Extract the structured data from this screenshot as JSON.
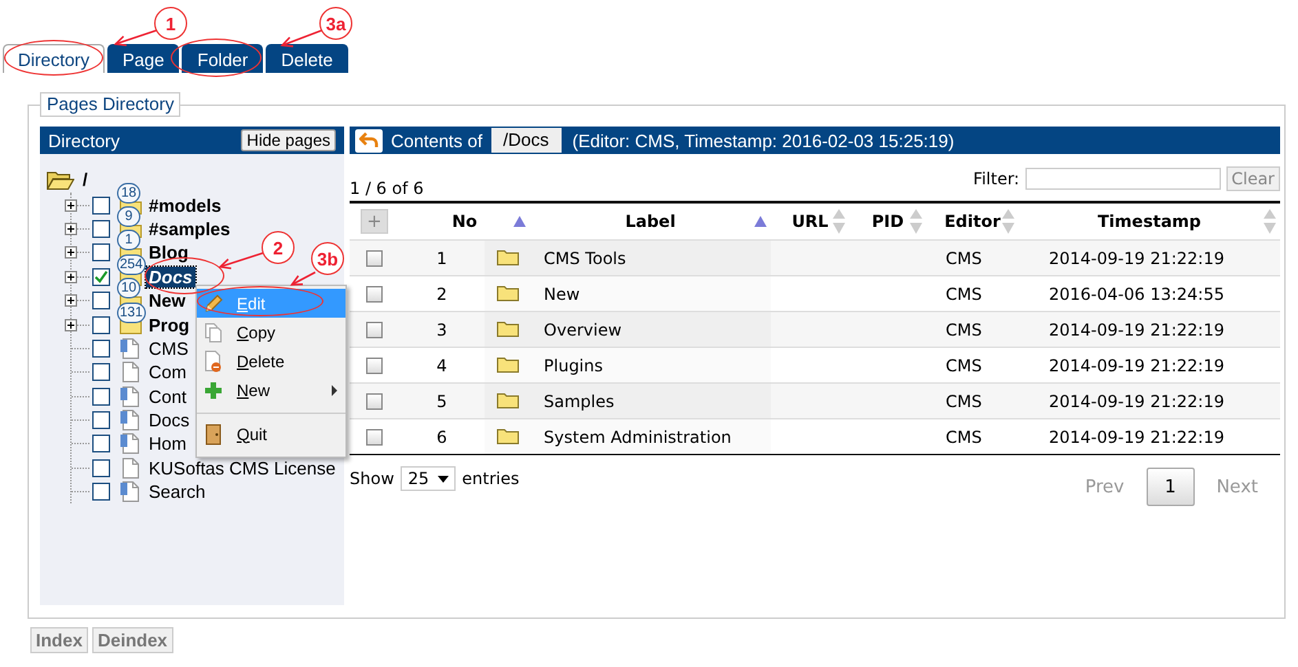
{
  "tabs": [
    {
      "label": "Directory",
      "selected": true
    },
    {
      "label": "Page",
      "selected": false
    },
    {
      "label": "Folder",
      "selected": false
    },
    {
      "label": "Delete",
      "selected": false
    }
  ],
  "panel": {
    "legend": "Pages Directory"
  },
  "directory": {
    "title": "Directory",
    "hide_button": "Hide pages",
    "root": "/",
    "items": [
      {
        "kind": "folder",
        "label": "#models",
        "count": "18",
        "checked": false,
        "selected": false
      },
      {
        "kind": "folder",
        "label": "#samples",
        "count": "9",
        "checked": false,
        "selected": false
      },
      {
        "kind": "folder",
        "label": "Blog",
        "count": "1",
        "checked": false,
        "selected": false
      },
      {
        "kind": "folder",
        "label": "Docs",
        "count": "254",
        "checked": true,
        "selected": true
      },
      {
        "kind": "folder",
        "label": "New",
        "count": "10",
        "checked": false,
        "selected": false
      },
      {
        "kind": "folder",
        "label": "Prog",
        "count": "131",
        "checked": false,
        "selected": false
      },
      {
        "kind": "module-page",
        "label": "CMS",
        "checked": false,
        "selected": false
      },
      {
        "kind": "page",
        "label": "Com",
        "checked": false,
        "selected": false
      },
      {
        "kind": "module-page",
        "label": "Cont",
        "checked": false,
        "selected": false
      },
      {
        "kind": "module-page",
        "label": "Docs",
        "checked": false,
        "selected": false
      },
      {
        "kind": "module-page",
        "label": "Hom",
        "checked": false,
        "selected": false
      },
      {
        "kind": "page",
        "label": "KUSoftas CMS License",
        "checked": false,
        "selected": false
      },
      {
        "kind": "module-page",
        "label": "Search",
        "checked": false,
        "selected": false
      }
    ]
  },
  "context_menu": [
    {
      "label": "Edit",
      "selected": true,
      "submenu": false,
      "separator_before": false
    },
    {
      "label": "Copy",
      "selected": false,
      "submenu": false,
      "separator_before": false
    },
    {
      "label": "Delete",
      "selected": false,
      "submenu": false,
      "separator_before": false
    },
    {
      "label": "New",
      "selected": false,
      "submenu": true,
      "separator_before": false
    },
    {
      "label": "Quit",
      "selected": false,
      "submenu": false,
      "separator_before": true
    }
  ],
  "contents": {
    "label": "Contents of",
    "path": "/Docs",
    "info": "(Editor: CMS, Timestamp: 2016-02-03 15:25:19)"
  },
  "table": {
    "summary": "1 / 6 of 6",
    "filter_label": "Filter:",
    "clear_button": "Clear",
    "add_button": "+",
    "columns": [
      {
        "label": "No",
        "sorted": true
      },
      {
        "label": "Label",
        "sorted": true
      },
      {
        "label": "URL",
        "sorted": false
      },
      {
        "label": "PID",
        "sorted": false
      },
      {
        "label": "Editor",
        "sorted": false
      },
      {
        "label": "Timestamp",
        "sorted": false
      }
    ],
    "rows": [
      {
        "no": "1",
        "label": "CMS Tools",
        "editor": "CMS",
        "timestamp": "2014-09-19 21:22:19",
        "checked": false
      },
      {
        "no": "2",
        "label": "New",
        "editor": "CMS",
        "timestamp": "2016-04-06 13:24:55",
        "checked": false
      },
      {
        "no": "3",
        "label": "Overview",
        "editor": "CMS",
        "timestamp": "2014-09-19 21:22:19",
        "checked": false
      },
      {
        "no": "4",
        "label": "Plugins",
        "editor": "CMS",
        "timestamp": "2014-09-19 21:22:19",
        "checked": false
      },
      {
        "no": "5",
        "label": "Samples",
        "editor": "CMS",
        "timestamp": "2014-09-19 21:22:19",
        "checked": false
      },
      {
        "no": "6",
        "label": "System Administration",
        "editor": "CMS",
        "timestamp": "2014-09-19 21:22:19",
        "checked": false
      }
    ],
    "show_label": "Show",
    "page_size": "25",
    "entries_label": "entries",
    "pagination": {
      "prev": "Prev",
      "pages": [
        {
          "label": "1",
          "selected": true
        }
      ],
      "next": "Next"
    }
  },
  "buttons": [
    {
      "label": "Index",
      "disabled": true
    },
    {
      "label": "Deindex",
      "disabled": true
    }
  ],
  "annotations": [
    {
      "label": "1"
    },
    {
      "label": "3a"
    },
    {
      "label": "2"
    },
    {
      "label": "3b"
    }
  ]
}
